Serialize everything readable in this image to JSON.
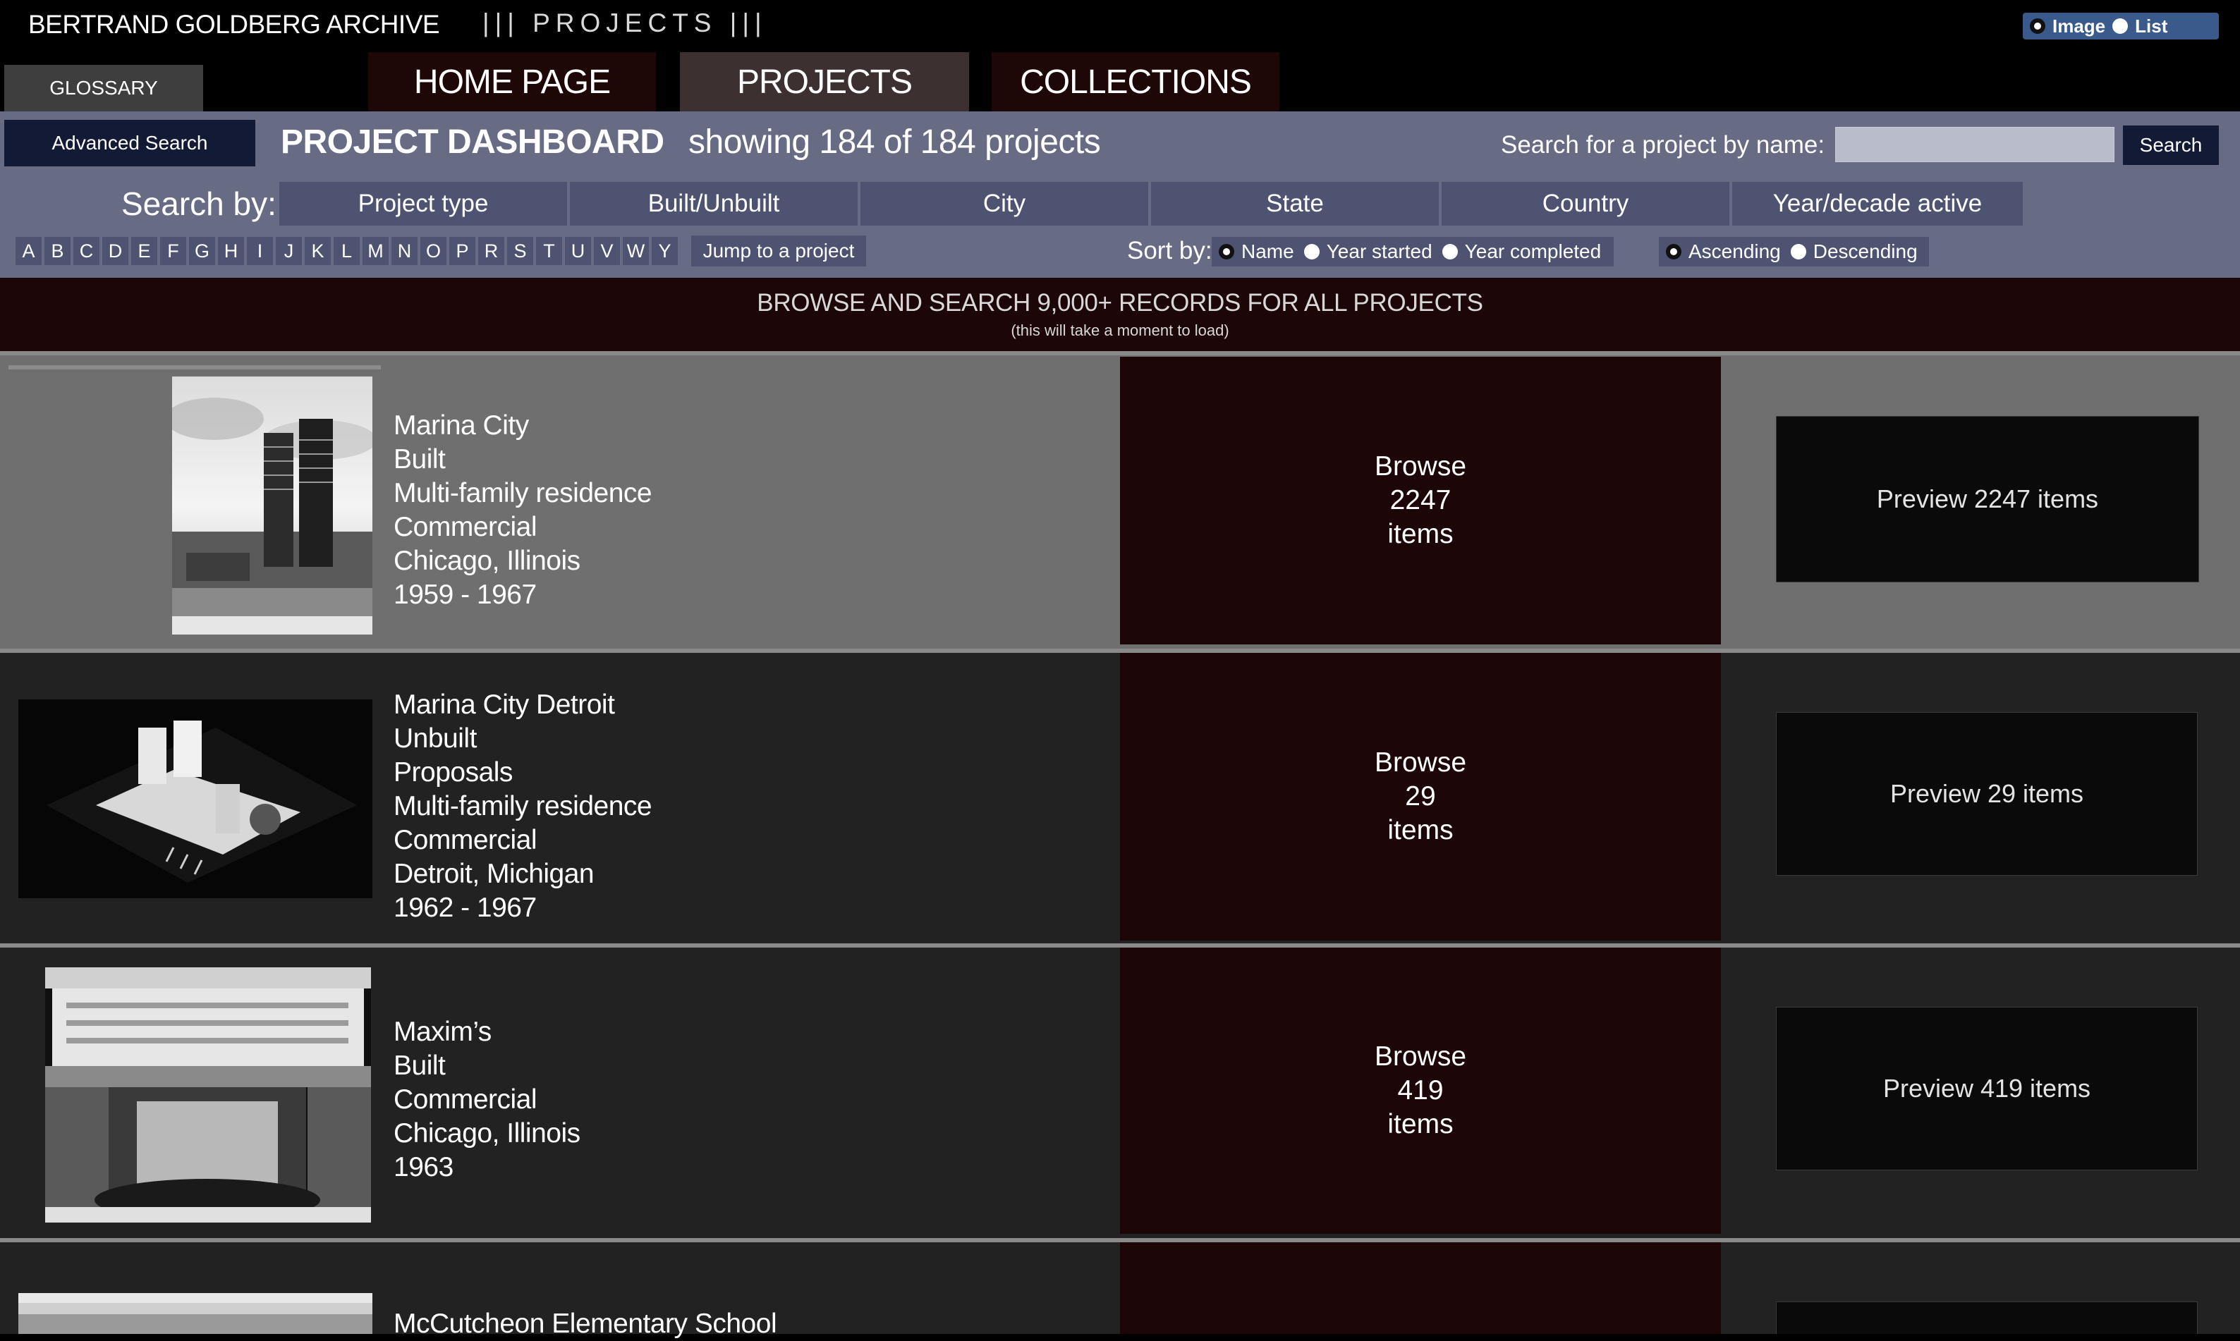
{
  "header": {
    "site_title": "BERTRAND GOLDBERG ARCHIVE",
    "section_title": "||| PROJECTS |||",
    "view_toggle": {
      "image_label": "Image",
      "list_label": "List",
      "selected": "Image"
    }
  },
  "nav": {
    "glossary_label": "GLOSSARY",
    "tabs": [
      {
        "label": "HOME PAGE"
      },
      {
        "label": "PROJECTS",
        "active": true
      },
      {
        "label": "COLLECTIONS"
      }
    ]
  },
  "dashboard": {
    "advanced_search_label": "Advanced Search",
    "title": "PROJECT DASHBOARD",
    "count_text": "showing 184 of 184 projects",
    "search_label": "Search for a project by name:",
    "search_value": "",
    "search_button": "Search",
    "search_by_label": "Search by:",
    "filters": [
      "Project type",
      "Built/Unbuilt",
      "City",
      "State",
      "Country",
      "Year/decade active"
    ],
    "letters": [
      "A",
      "B",
      "C",
      "D",
      "E",
      "F",
      "G",
      "H",
      "I",
      "J",
      "K",
      "L",
      "M",
      "N",
      "O",
      "P",
      "R",
      "S",
      "T",
      "U",
      "V",
      "W",
      "Y"
    ],
    "jump_label": "Jump to a project",
    "sort_by_label": "Sort by:",
    "sort_fields": [
      {
        "label": "Name",
        "checked": true
      },
      {
        "label": "Year started",
        "checked": false
      },
      {
        "label": "Year completed",
        "checked": false
      }
    ],
    "sort_orders": [
      {
        "label": "Ascending",
        "checked": true
      },
      {
        "label": "Descending",
        "checked": false
      }
    ]
  },
  "banner": {
    "title": "BROWSE AND SEARCH 9,000+ RECORDS FOR ALL PROJECTS",
    "note": "(this will take a moment to load)"
  },
  "projects": [
    {
      "name": "Marina City",
      "lines": [
        "Built",
        "Multi-family residence",
        "Commercial",
        "Chicago, Illinois",
        "1959 - 1967"
      ],
      "browse": [
        "Browse",
        "2247",
        "items"
      ],
      "preview_label": "Preview 2247 items"
    },
    {
      "name": "Marina City Detroit",
      "lines": [
        "Unbuilt",
        "Proposals",
        "Multi-family residence",
        "Commercial",
        "Detroit, Michigan",
        "1962 - 1967"
      ],
      "browse": [
        "Browse",
        "29",
        "items"
      ],
      "preview_label": "Preview 29 items"
    },
    {
      "name": "Maxim’s",
      "lines": [
        "Built",
        "Commercial",
        "Chicago, Illinois",
        "1963"
      ],
      "browse": [
        "Browse",
        "419",
        "items"
      ],
      "preview_label": "Preview 419 items"
    },
    {
      "name": "McCutcheon Elementary School",
      "lines": [],
      "browse": [],
      "preview_label": ""
    }
  ],
  "thumbnails": {
    "marina_city": "marina-city-photo",
    "marina_city_detroit": "model-photo",
    "maxims": "storefront-photo",
    "mccutcheon": "school-photo"
  }
}
